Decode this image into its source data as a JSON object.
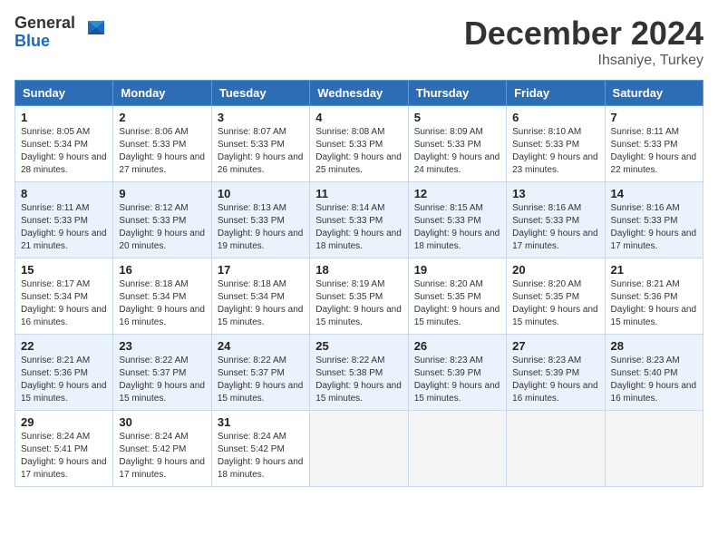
{
  "header": {
    "logo_general": "General",
    "logo_blue": "Blue",
    "month_title": "December 2024",
    "location": "Ihsaniye, Turkey"
  },
  "days_of_week": [
    "Sunday",
    "Monday",
    "Tuesday",
    "Wednesday",
    "Thursday",
    "Friday",
    "Saturday"
  ],
  "weeks": [
    [
      {
        "day": "1",
        "sunrise": "8:05 AM",
        "sunset": "5:34 PM",
        "daylight": "9 hours and 28 minutes."
      },
      {
        "day": "2",
        "sunrise": "8:06 AM",
        "sunset": "5:33 PM",
        "daylight": "9 hours and 27 minutes."
      },
      {
        "day": "3",
        "sunrise": "8:07 AM",
        "sunset": "5:33 PM",
        "daylight": "9 hours and 26 minutes."
      },
      {
        "day": "4",
        "sunrise": "8:08 AM",
        "sunset": "5:33 PM",
        "daylight": "9 hours and 25 minutes."
      },
      {
        "day": "5",
        "sunrise": "8:09 AM",
        "sunset": "5:33 PM",
        "daylight": "9 hours and 24 minutes."
      },
      {
        "day": "6",
        "sunrise": "8:10 AM",
        "sunset": "5:33 PM",
        "daylight": "9 hours and 23 minutes."
      },
      {
        "day": "7",
        "sunrise": "8:11 AM",
        "sunset": "5:33 PM",
        "daylight": "9 hours and 22 minutes."
      }
    ],
    [
      {
        "day": "8",
        "sunrise": "8:11 AM",
        "sunset": "5:33 PM",
        "daylight": "9 hours and 21 minutes."
      },
      {
        "day": "9",
        "sunrise": "8:12 AM",
        "sunset": "5:33 PM",
        "daylight": "9 hours and 20 minutes."
      },
      {
        "day": "10",
        "sunrise": "8:13 AM",
        "sunset": "5:33 PM",
        "daylight": "9 hours and 19 minutes."
      },
      {
        "day": "11",
        "sunrise": "8:14 AM",
        "sunset": "5:33 PM",
        "daylight": "9 hours and 18 minutes."
      },
      {
        "day": "12",
        "sunrise": "8:15 AM",
        "sunset": "5:33 PM",
        "daylight": "9 hours and 18 minutes."
      },
      {
        "day": "13",
        "sunrise": "8:16 AM",
        "sunset": "5:33 PM",
        "daylight": "9 hours and 17 minutes."
      },
      {
        "day": "14",
        "sunrise": "8:16 AM",
        "sunset": "5:33 PM",
        "daylight": "9 hours and 17 minutes."
      }
    ],
    [
      {
        "day": "15",
        "sunrise": "8:17 AM",
        "sunset": "5:34 PM",
        "daylight": "9 hours and 16 minutes."
      },
      {
        "day": "16",
        "sunrise": "8:18 AM",
        "sunset": "5:34 PM",
        "daylight": "9 hours and 16 minutes."
      },
      {
        "day": "17",
        "sunrise": "8:18 AM",
        "sunset": "5:34 PM",
        "daylight": "9 hours and 15 minutes."
      },
      {
        "day": "18",
        "sunrise": "8:19 AM",
        "sunset": "5:35 PM",
        "daylight": "9 hours and 15 minutes."
      },
      {
        "day": "19",
        "sunrise": "8:20 AM",
        "sunset": "5:35 PM",
        "daylight": "9 hours and 15 minutes."
      },
      {
        "day": "20",
        "sunrise": "8:20 AM",
        "sunset": "5:35 PM",
        "daylight": "9 hours and 15 minutes."
      },
      {
        "day": "21",
        "sunrise": "8:21 AM",
        "sunset": "5:36 PM",
        "daylight": "9 hours and 15 minutes."
      }
    ],
    [
      {
        "day": "22",
        "sunrise": "8:21 AM",
        "sunset": "5:36 PM",
        "daylight": "9 hours and 15 minutes."
      },
      {
        "day": "23",
        "sunrise": "8:22 AM",
        "sunset": "5:37 PM",
        "daylight": "9 hours and 15 minutes."
      },
      {
        "day": "24",
        "sunrise": "8:22 AM",
        "sunset": "5:37 PM",
        "daylight": "9 hours and 15 minutes."
      },
      {
        "day": "25",
        "sunrise": "8:22 AM",
        "sunset": "5:38 PM",
        "daylight": "9 hours and 15 minutes."
      },
      {
        "day": "26",
        "sunrise": "8:23 AM",
        "sunset": "5:39 PM",
        "daylight": "9 hours and 15 minutes."
      },
      {
        "day": "27",
        "sunrise": "8:23 AM",
        "sunset": "5:39 PM",
        "daylight": "9 hours and 16 minutes."
      },
      {
        "day": "28",
        "sunrise": "8:23 AM",
        "sunset": "5:40 PM",
        "daylight": "9 hours and 16 minutes."
      }
    ],
    [
      {
        "day": "29",
        "sunrise": "8:24 AM",
        "sunset": "5:41 PM",
        "daylight": "9 hours and 17 minutes."
      },
      {
        "day": "30",
        "sunrise": "8:24 AM",
        "sunset": "5:42 PM",
        "daylight": "9 hours and 17 minutes."
      },
      {
        "day": "31",
        "sunrise": "8:24 AM",
        "sunset": "5:42 PM",
        "daylight": "9 hours and 18 minutes."
      },
      null,
      null,
      null,
      null
    ]
  ]
}
